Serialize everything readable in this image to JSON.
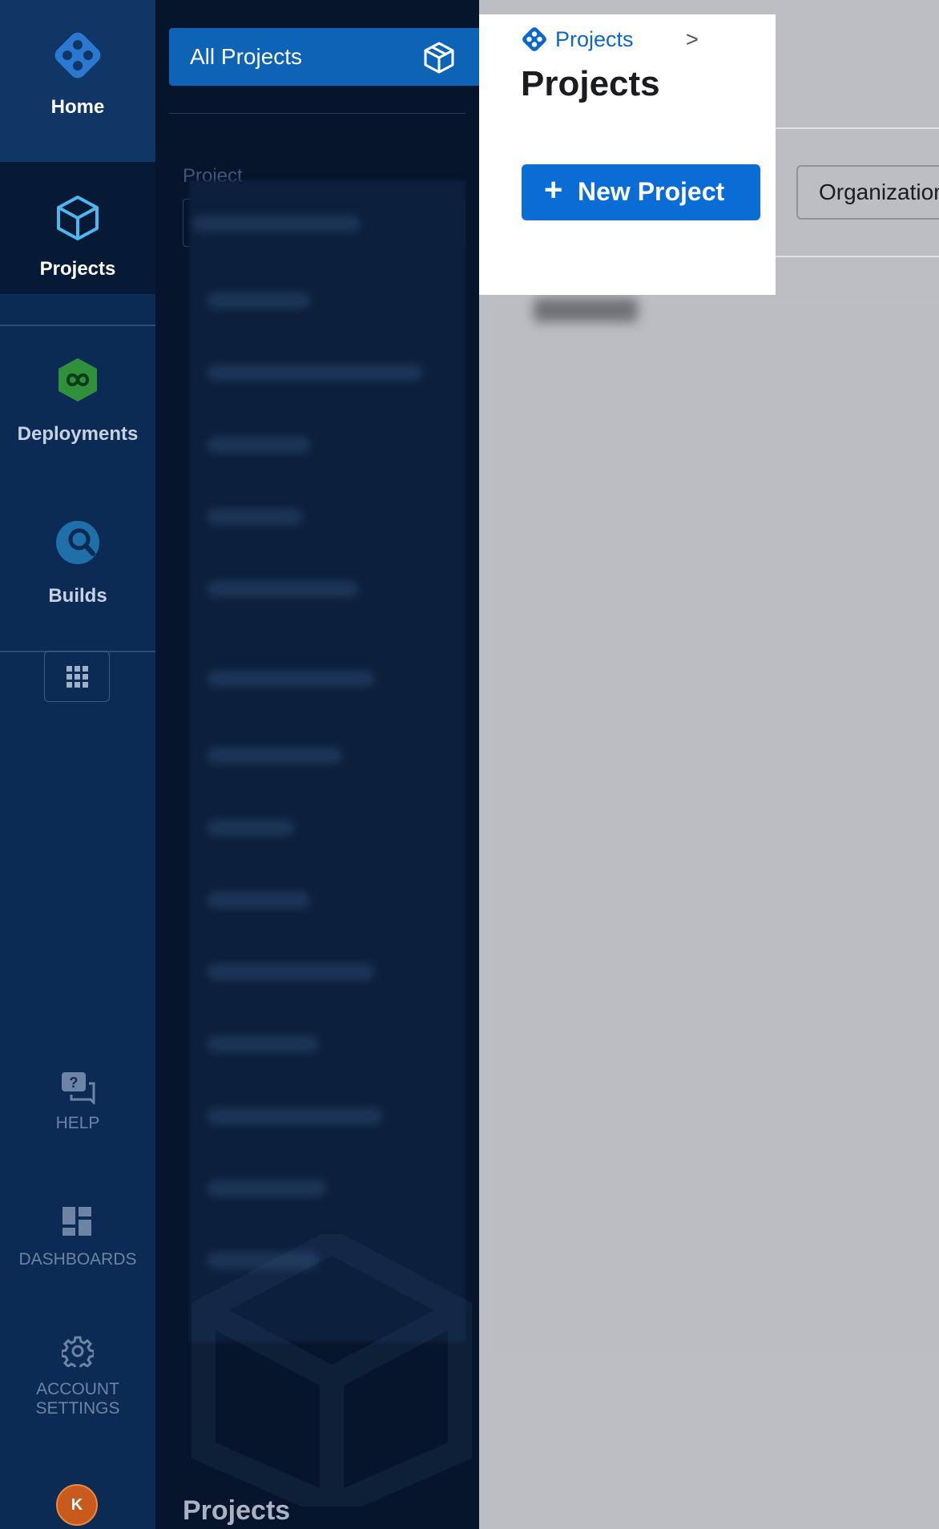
{
  "rail": {
    "home_label": "Home",
    "projects_label": "Projects",
    "deployments_label": "Deployments",
    "builds_label": "Builds",
    "help_label": "HELP",
    "dashboards_label": "DASHBOARDS",
    "account_label_1": "ACCOUNT",
    "account_label_2": "SETTINGS",
    "avatar_initial": "K"
  },
  "drawer": {
    "all_projects_label": "All Projects",
    "project_field_label": "Project",
    "footer_title": "Projects"
  },
  "header": {
    "breadcrumb": "Projects",
    "breadcrumb_separator": ">",
    "title": "Projects",
    "new_project_plus": "+",
    "new_project_label": "New Project",
    "organization_label": "Organization"
  },
  "colors": {
    "accent": "#0a6dd6",
    "rail_bg": "#0b2a54",
    "drawer_bg": "#06152b",
    "deployments_icon": "#2f8f3a",
    "builds_icon": "#1f6fa8"
  },
  "icons": {
    "home": "harness-logo-icon",
    "projects": "cube-icon",
    "deployments": "infinity-icon",
    "builds": "magnifier-icon",
    "apps": "grid-icon",
    "help": "help-chat-icon",
    "dashboards": "dashboard-icon",
    "account": "gear-icon"
  }
}
